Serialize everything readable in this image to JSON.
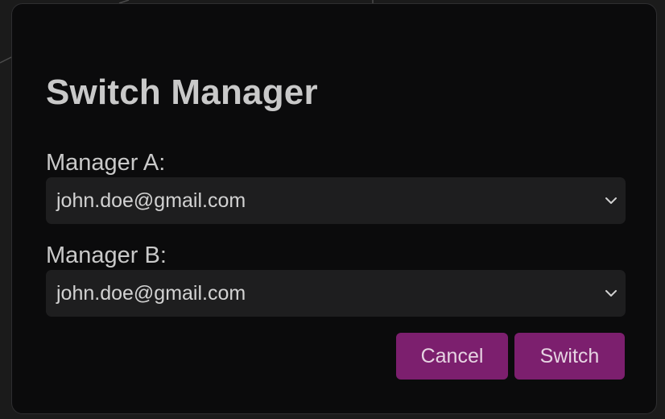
{
  "dialog": {
    "title": "Switch Manager",
    "manager_a": {
      "label": "Manager A:",
      "selected": "john.doe@gmail.com"
    },
    "manager_b": {
      "label": "Manager B:",
      "selected": "john.doe@gmail.com"
    },
    "buttons": {
      "cancel": "Cancel",
      "switch": "Switch"
    }
  },
  "icons": {
    "dropdown": "chevron-down-icon"
  },
  "colors": {
    "accent": "#7c1f6e",
    "dialog_bg": "#0b0b0c",
    "field_bg": "#1e1e1f",
    "text": "#c9c9c9"
  }
}
